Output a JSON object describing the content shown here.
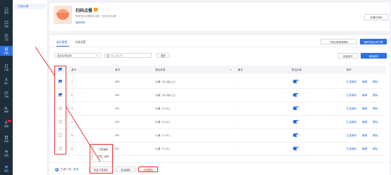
{
  "leftnav": [
    {
      "icon": "shop-icon",
      "label": "概况"
    },
    {
      "icon": "goods-icon",
      "label": "商品"
    },
    {
      "icon": "store-icon",
      "label": "门店"
    },
    {
      "icon": "qrcode-icon",
      "label": "扫码",
      "active": true
    },
    {
      "icon": "order-icon",
      "label": "订单"
    },
    {
      "icon": "member-icon",
      "label": "客户"
    },
    {
      "icon": "finance-icon",
      "label": "订单"
    },
    {
      "icon": "data-icon",
      "label": "数据"
    },
    {
      "icon": "marketing-icon",
      "label": "营销",
      "badge": true
    },
    {
      "icon": "app-icon",
      "label": "应用"
    },
    {
      "icon": "settings-icon",
      "label": "设置"
    },
    {
      "icon": "avatar-icon",
      "label": "店员"
    }
  ],
  "subnav": {
    "item": "扫码点餐"
  },
  "store": {
    "name": "扫码点餐",
    "badge": "V",
    "description": "堂食扫码点餐助手功能，支持扫码点餐",
    "link": "使用说明",
    "button": "店铺扫码码"
  },
  "tabs": [
    {
      "label": "桌台管理",
      "active": true
    },
    {
      "label": "点餐设置",
      "active": false
    }
  ],
  "toolbar": {
    "hint_button": "下载点餐海报物料",
    "primary_button": "桌码扫码点单下载",
    "batch_button": "批量操作",
    "add_button": "新增桌号"
  },
  "filter": {
    "select_value": "桌台区域全部",
    "search_placeholder": "输入桌台号",
    "search_button": "搜索"
  },
  "table": {
    "headers": [
      "桌号",
      "桌号",
      "桌台类型",
      "备注",
      "是否启用",
      "操作"
    ],
    "rows": [
      {
        "idx": "1",
        "code": "008",
        "type": "大桌（5人及以上）",
        "note": "-",
        "checked": true
      },
      {
        "idx": "2",
        "code": "005",
        "type": "大桌（5人及以上）",
        "note": "-",
        "checked": true
      },
      {
        "idx": "3",
        "code": "003",
        "type": "中桌（3-4人）",
        "note": "-",
        "checked": false
      },
      {
        "idx": "4",
        "code": "002",
        "type": "中桌（3-4人）",
        "note": "-",
        "checked": false
      },
      {
        "idx": "5",
        "code": "003",
        "type": "小桌（1-2人）",
        "note": "-",
        "checked": false
      },
      {
        "idx": "6",
        "code": "001",
        "type": "小桌（1-2人）",
        "note": "-",
        "checked": false
      }
    ],
    "actions": [
      "生成桌码",
      "编辑",
      "删除"
    ]
  },
  "popup": {
    "options": [
      "下载海报",
      "下载二维码"
    ]
  },
  "bottom": {
    "selected": "已选 2 项",
    "cancel": "取消",
    "download": "批量下载桌码",
    "batch_edit": "批量编辑",
    "batch_delete": "批量删除"
  },
  "colors": {
    "accent": "#2f6fe0",
    "annotation": "#e53935",
    "nav_bg": "#1f2d3d"
  }
}
